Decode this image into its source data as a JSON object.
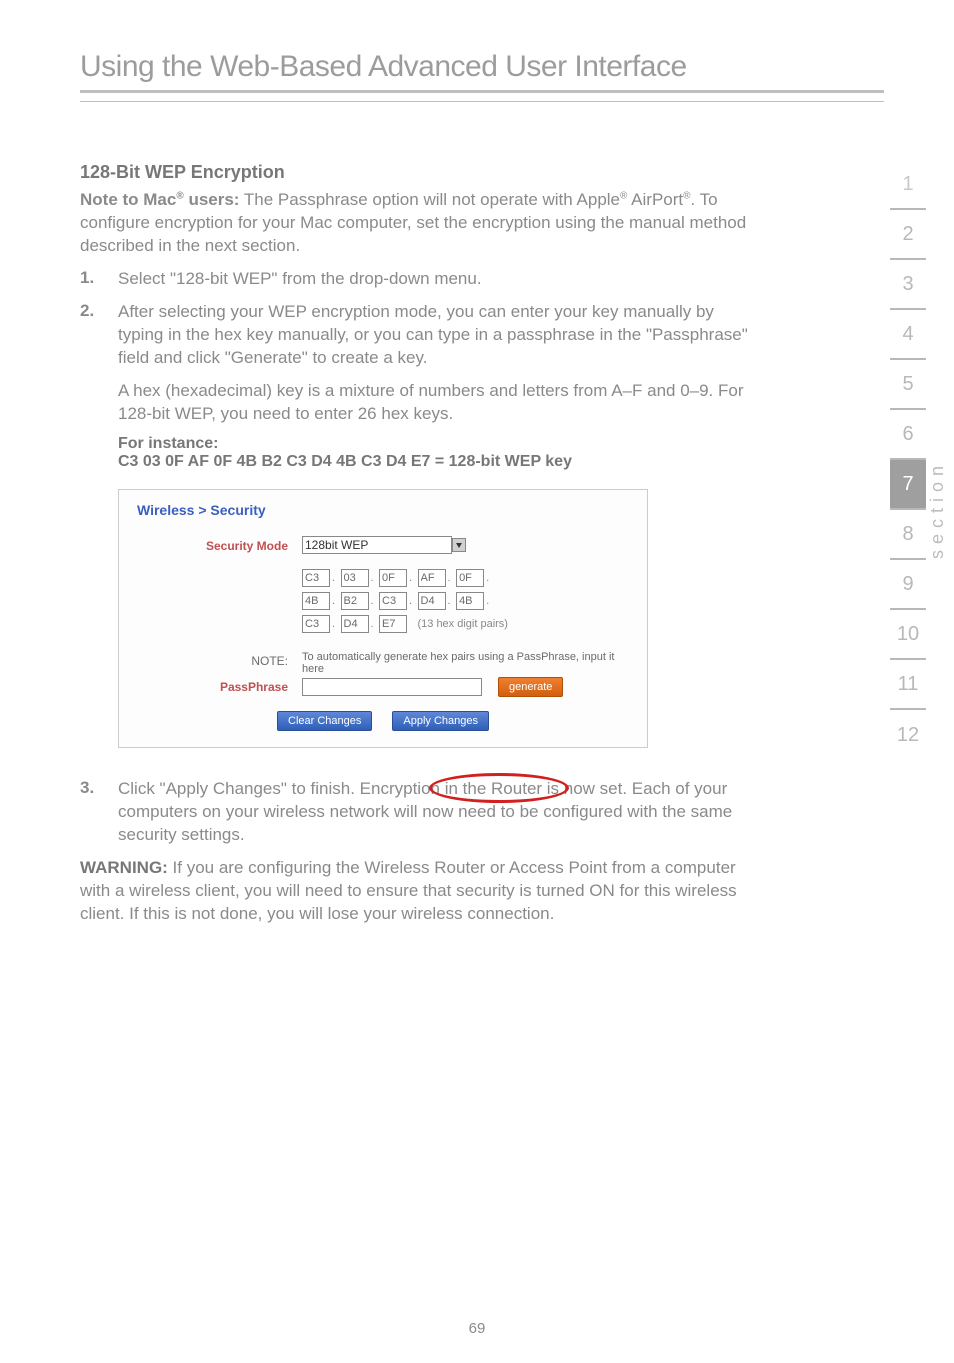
{
  "chapterTitle": "Using the Web-Based Advanced User Interface",
  "section": {
    "heading": "128-Bit WEP Encryption",
    "noteLead": "Note to Mac",
    "noteLead2": " users:",
    "noteBody": " The Passphrase option will not operate with Apple",
    "noteBody2": " AirPort",
    "noteBody3": ". To configure encryption for your Mac computer, set the encryption using the manual method described in the next section.",
    "step1Num": "1.",
    "step1": "Select \"128-bit WEP\" from the drop-down menu.",
    "step2Num": "2.",
    "step2": "After selecting your WEP encryption mode, you can enter your key manually by typing in the hex key manually, or you can type in a passphrase in the \"Passphrase\" field and click \"Generate\" to create a key.",
    "hexPara": "A hex (hexadecimal) key is a mixture of numbers and letters from A–F and 0–9. For 128-bit WEP, you need to enter 26 hex keys.",
    "fiLabel": "For instance:",
    "fiExample": "C3 03 0F AF 0F 4B B2 C3 D4 4B C3 D4 E7 = 128-bit WEP key",
    "step3Num": "3.",
    "step3": "Click \"Apply Changes\" to finish. Encryption in the Router is now set. Each of your computers on your wireless network will now need to be configured with the same security settings.",
    "warnLabel": "WARNING:",
    "warnBody": " If you are configuring the Wireless Router or Access Point from a computer with a wireless client, you will need to ensure that security is turned ON for this wireless client. If this is not done, you will lose your wireless connection."
  },
  "screenshot": {
    "title": "Wireless > Security",
    "modeLabel": "Security Mode",
    "modeValue": "128bit WEP",
    "hex": {
      "r1": [
        "C3",
        "03",
        "0F",
        "AF",
        "0F"
      ],
      "r2": [
        "4B",
        "B2",
        "C3",
        "D4",
        "4B"
      ],
      "r3": [
        "C3",
        "D4",
        "E7"
      ]
    },
    "hexNote": "(13 hex digit pairs)",
    "noteLabel": "NOTE:",
    "noteText": "To automatically generate hex pairs using a PassPhrase, input it here",
    "passLabel": "PassPhrase",
    "genBtn": "generate",
    "clearBtn": "Clear Changes",
    "applyBtn": "Apply Changes"
  },
  "sidetabs": [
    "1",
    "2",
    "3",
    "4",
    "5",
    "6",
    "7",
    "8",
    "9",
    "10",
    "11",
    "12"
  ],
  "sectionWord": "section",
  "activeTab": "7",
  "pageNumber": "69"
}
